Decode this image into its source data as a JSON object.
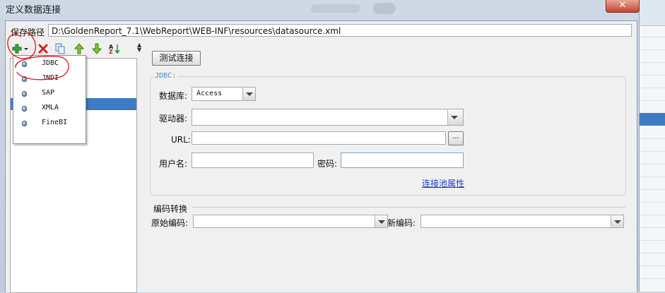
{
  "window": {
    "title": "定义数据连接",
    "close_label": "✕"
  },
  "path": {
    "label": "保存路径",
    "value": "D:\\GoldenReport_7.1\\WebReport\\WEB-INF\\resources\\datasource.xml"
  },
  "toolbar": {
    "add_icon": "plus-icon",
    "delete_icon": "red-x-icon",
    "copy_icon": "copy-icon",
    "up_icon": "green-up-arrow-icon",
    "down_icon": "green-down-arrow-icon",
    "sort_icon": "sort-az-icon"
  },
  "dropdown": {
    "items": [
      "JDBC",
      "JNDI",
      "SAP",
      "XMLA",
      "FineBI"
    ]
  },
  "right": {
    "test_button": "测试连接",
    "jdbc_group": "JDBC:",
    "db_label": "数据库:",
    "db_value": "Access",
    "driver_label": "驱动器:",
    "driver_value": "",
    "url_label": "URL:",
    "url_value": "",
    "browse_label": "...",
    "user_label": "用户名:",
    "user_value": "",
    "pwd_label": "密码:",
    "pwd_value": "",
    "pool_link": "连接池属性",
    "encoding_group": "编码转换",
    "orig_label": "原始编码:",
    "orig_value": "",
    "new_label": "新编码:",
    "new_value": ""
  },
  "colors": {
    "selection": "#3f7bc4",
    "legend": "#3b8fd1",
    "link": "#1a3fc2",
    "annotation": "#e0141e"
  }
}
